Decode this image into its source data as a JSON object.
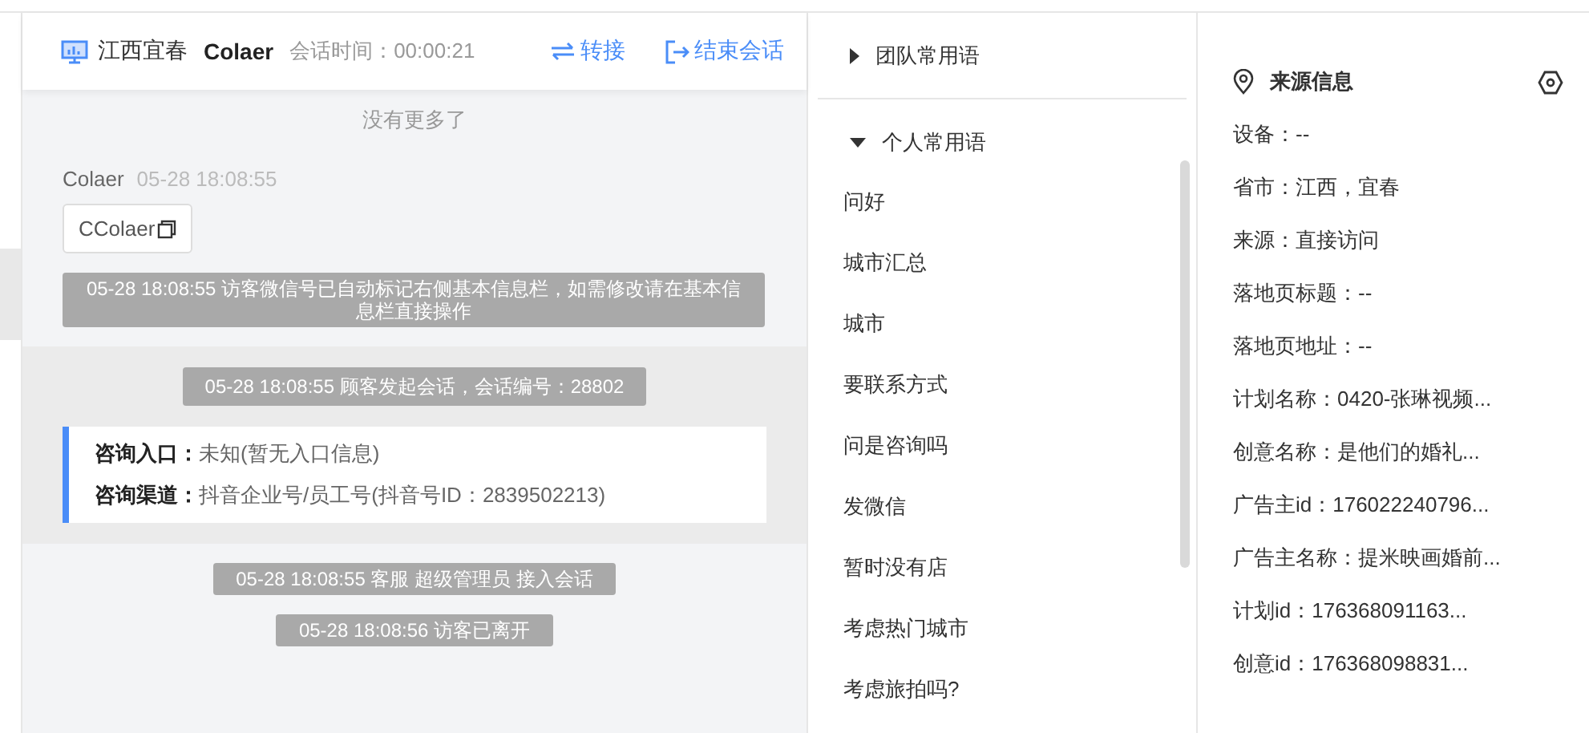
{
  "header": {
    "location": "江西宜春",
    "visitor": "Colaer",
    "duration": "会话时间：00:00:21",
    "actions": [
      {
        "kind": "transfer",
        "label": "转接"
      },
      {
        "kind": "end",
        "label": "结束会话"
      }
    ]
  },
  "chat": {
    "notice": "没有更多了",
    "messages": [
      {
        "kind": "visitor",
        "sender": "Colaer",
        "time": "05-28 18:08:55",
        "text": "CColaer"
      },
      {
        "kind": "system",
        "text": "05-28 18:08:55 访客微信号已自动标记右侧基本信息栏，如需修改请在基本信息栏直接操作"
      },
      {
        "kind": "group",
        "messages": [
          {
            "kind": "system",
            "text": "05-28 18:08:55 顾客发起会话，会话编号：28802"
          },
          {
            "kind": "info",
            "fields": [
              {
                "label": "咨询入口：",
                "value": "未知(暂无入口信息)"
              },
              {
                "label": "咨询渠道：",
                "value": "抖音企业号/员工号(抖音号ID：2839502213)"
              }
            ]
          }
        ]
      },
      {
        "kind": "system",
        "text": "05-28 18:08:55 客服 超级管理员 接入会话"
      },
      {
        "kind": "system",
        "text": "05-28 18:08:56 访客已离开"
      }
    ]
  },
  "phrases": {
    "groups": [
      {
        "title": "团队常用语",
        "expanded": false
      },
      {
        "title": "个人常用语",
        "expanded": true,
        "items": [
          "问好",
          "城市汇总",
          "城市",
          "要联系方式",
          "问是咨询吗",
          "发微信",
          "暂时没有店",
          "考虑热门城市",
          "考虑旅拍吗?"
        ]
      }
    ]
  },
  "source": {
    "title": "来源信息",
    "rows": [
      "设备：--",
      "省市：江西，宜春",
      "来源：直接访问",
      "落地页标题：--",
      "落地页地址：--",
      "计划名称：0420-张琳视频...",
      "创意名称：是他们的婚礼...",
      "广告主id：176022240796...",
      "广告主名称：提米映画婚前...",
      "计划id：176368091163...",
      "创意id：176368098831..."
    ]
  }
}
